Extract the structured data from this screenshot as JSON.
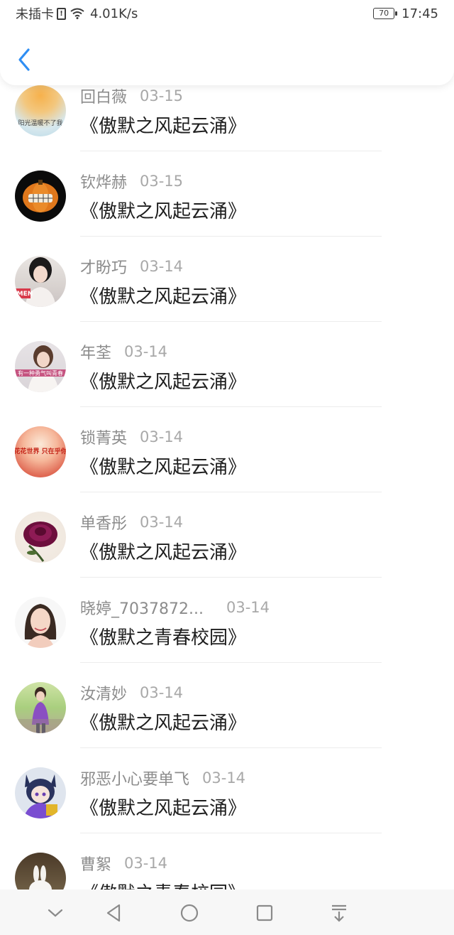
{
  "status_bar": {
    "carrier": "未插卡",
    "sim_icon_text": "!",
    "network_speed": "4.01K/s",
    "battery_level": "70",
    "time": "17:45"
  },
  "header": {
    "back_icon": "chevron-left-icon",
    "accent_color": "#2f8ef3"
  },
  "items": [
    {
      "name": "回白薇",
      "date": "03-15",
      "title": "《傲默之风起云涌》",
      "avatar_text": "阳光温暖不了我"
    },
    {
      "name": "钦烨赫",
      "date": "03-15",
      "title": "《傲默之风起云涌》"
    },
    {
      "name": "才盼巧",
      "date": "03-14",
      "title": "《傲默之风起云涌》",
      "avatar_text": "MEN"
    },
    {
      "name": "年荃",
      "date": "03-14",
      "title": "《傲默之风起云涌》",
      "avatar_text": "有一种勇气叫青春"
    },
    {
      "name": "锁菁英",
      "date": "03-14",
      "title": "《傲默之风起云涌》",
      "avatar_text": "花花世界 只在乎你"
    },
    {
      "name": "单香彤",
      "date": "03-14",
      "title": "《傲默之风起云涌》"
    },
    {
      "name": "晓婷_7037872...",
      "date": "03-14",
      "title": "《傲默之青春校园》"
    },
    {
      "name": "汝清妙",
      "date": "03-14",
      "title": "《傲默之风起云涌》"
    },
    {
      "name": "邪恶小心要单飞",
      "date": "03-14",
      "title": "《傲默之风起云涌》"
    },
    {
      "name": "曹絮",
      "date": "03-14",
      "title": "《傲默之青春校园》"
    }
  ],
  "bottom_nav": [
    "chevron-down-icon",
    "back-triangle-icon",
    "home-circle-icon",
    "recents-square-icon",
    "pull-down-icon"
  ]
}
